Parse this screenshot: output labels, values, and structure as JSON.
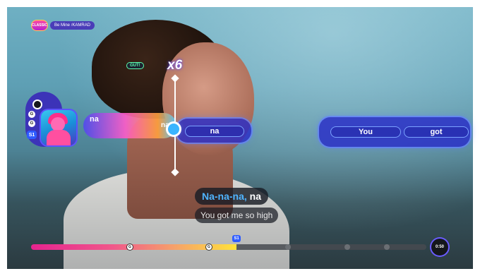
{
  "header": {
    "mode_badge": "CLASSIC",
    "song_title": "Be Mine",
    "separator": "/",
    "artist": "KAMRAD"
  },
  "player": {
    "rank": "S1",
    "icon_a": "G",
    "icon_b": "G"
  },
  "combo": {
    "rating": "GUT!",
    "multiplier": "x6"
  },
  "lanes": {
    "trail_label": "na",
    "trail_label_2": "na",
    "current_note": "na",
    "upcoming_notes": [
      "You",
      "got"
    ]
  },
  "lyrics": {
    "line1_sung": "Na-na-na,",
    "line1_unsung": " na",
    "line2": "You got me so high"
  },
  "progress": {
    "fraction": 0.52,
    "position_flag": "S1",
    "marker_icon_1": "G",
    "marker_icon_2": "G",
    "time": "0:50"
  },
  "colors": {
    "accent_blue": "#2e5bff",
    "lane_blue": "#2832c8",
    "sung_lyric": "#4fb4ff",
    "progress_start": "#e6238f",
    "progress_end": "#ffe23a"
  }
}
